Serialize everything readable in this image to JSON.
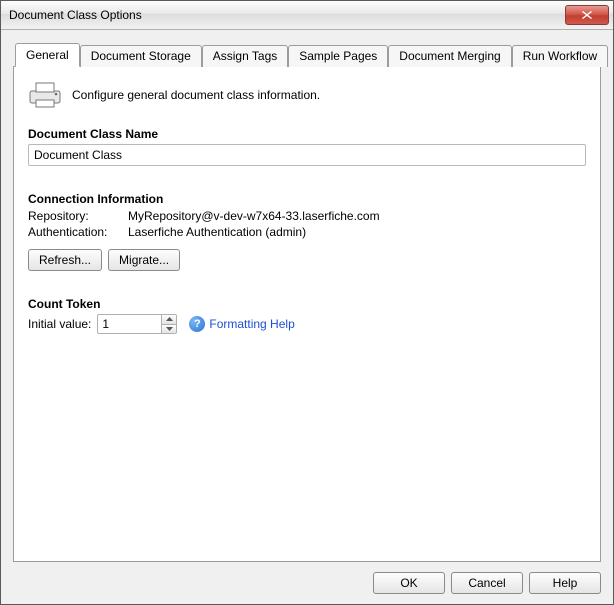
{
  "window": {
    "title": "Document Class Options"
  },
  "tabs": [
    {
      "label": "General"
    },
    {
      "label": "Document Storage"
    },
    {
      "label": "Assign Tags"
    },
    {
      "label": "Sample Pages"
    },
    {
      "label": "Document Merging"
    },
    {
      "label": "Run Workflow"
    }
  ],
  "intro": "Configure general document class information.",
  "docClass": {
    "heading": "Document Class Name",
    "value": "Document Class"
  },
  "connection": {
    "heading": "Connection Information",
    "repoLabel": "Repository:",
    "repoValue": "MyRepository@v-dev-w7x64-33.laserfiche.com",
    "authLabel": "Authentication:",
    "authValue": "Laserfiche Authentication (admin)",
    "refresh": "Refresh...",
    "migrate": "Migrate..."
  },
  "countToken": {
    "heading": "Count Token",
    "initialLabel": "Initial value:",
    "value": "1",
    "helpLabel": "Formatting Help"
  },
  "footer": {
    "ok": "OK",
    "cancel": "Cancel",
    "help": "Help"
  }
}
